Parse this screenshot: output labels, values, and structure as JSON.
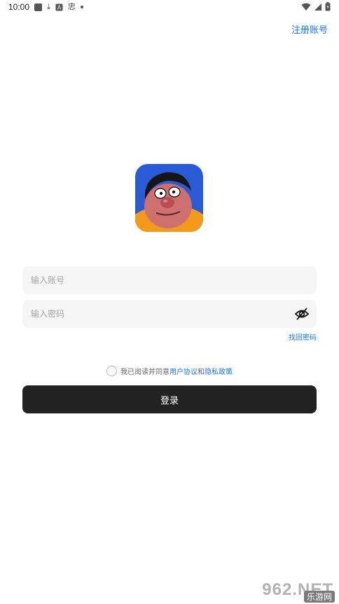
{
  "status_bar": {
    "time": "10:00",
    "chinese_char": "忠",
    "icons_left": [
      "square-icon",
      "download-icon",
      "a-box-icon",
      "dot-icon"
    ],
    "icons_right": [
      "wifi-icon",
      "signal-icon",
      "battery-icon"
    ]
  },
  "header": {
    "register_label": "注册账号"
  },
  "logo": {
    "icon": "cartoon-avatar-logo",
    "bg_color": "#2a5bd7",
    "shirt_color": "#f39a1a"
  },
  "form": {
    "account_placeholder": "输入账号",
    "password_placeholder": "输入密码",
    "forgot_password_label": "找回密码"
  },
  "agreement": {
    "prefix": "我已阅读并同意",
    "user_agreement": "用户协议",
    "and": "和",
    "privacy_policy": "隐私政策"
  },
  "login_button_label": "登录",
  "watermark": {
    "text": "962.NET",
    "sub": "乐游网"
  },
  "colors": {
    "accent": "#1677ff",
    "button": "#222222",
    "field_bg": "#f5f5f5"
  }
}
